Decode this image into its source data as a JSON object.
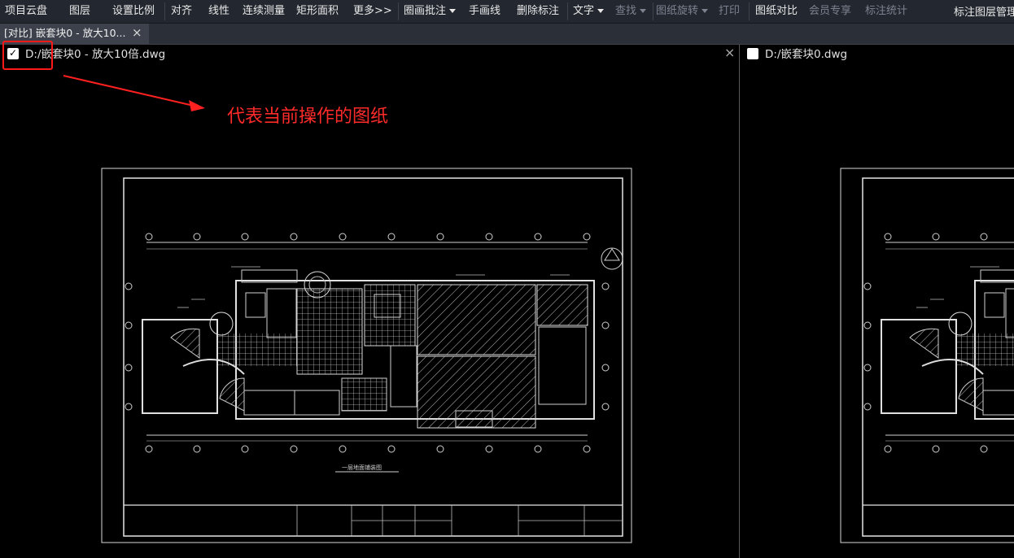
{
  "toolbar": {
    "items": [
      {
        "label": "项目云盘"
      },
      {
        "label": "图层"
      },
      {
        "label": "设置比例"
      },
      {
        "label": "对齐"
      },
      {
        "label": "线性"
      },
      {
        "label": "连续测量"
      },
      {
        "label": "矩形面积"
      },
      {
        "label": "更多>>"
      },
      {
        "label": "圈画批注"
      },
      {
        "label": "手画线"
      },
      {
        "label": "删除标注"
      },
      {
        "label": "文字"
      },
      {
        "label": "查找"
      },
      {
        "label": "图纸旋转"
      },
      {
        "label": "打印"
      },
      {
        "label": "图纸对比"
      },
      {
        "label": "会员专享"
      },
      {
        "label": "标注统计"
      },
      {
        "label": "标注图层管理"
      }
    ]
  },
  "tab": {
    "label": "[对比] 嵌套块0 - 放大10...",
    "close": "×"
  },
  "left_pane": {
    "file": "D:/嵌套块0 - 放大10倍.dwg",
    "checked": true,
    "close": "×"
  },
  "right_pane": {
    "file": "D:/嵌套块0.dwg",
    "checked": false
  },
  "annotation": {
    "text": "代表当前操作的图纸",
    "color": "#ff2a2a"
  },
  "drawing": {
    "title": "一层地面铺装图"
  }
}
